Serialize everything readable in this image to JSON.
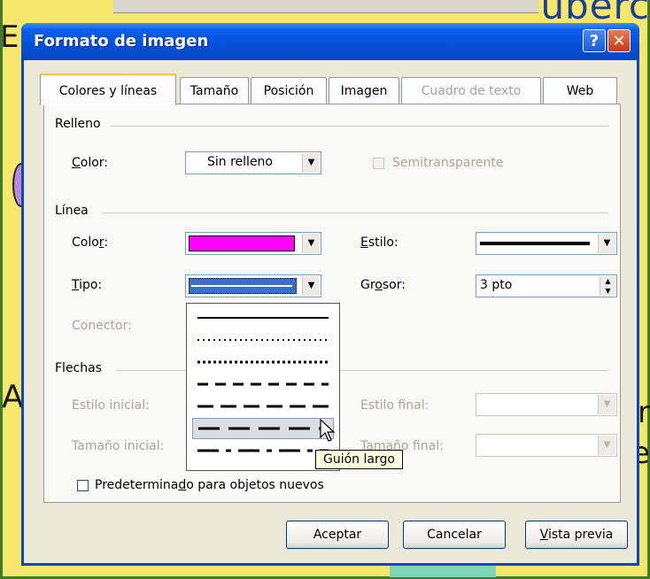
{
  "background": {
    "top_word": "uberc",
    "left_letter": "E",
    "left_letter_2": "A",
    "right_letter_1": "r",
    "right_letter_2": "e"
  },
  "dialog": {
    "title": "Formato de imagen",
    "help_label": "?",
    "close_label": "✕"
  },
  "tabs": [
    {
      "label": "Colores y líneas",
      "active": true,
      "disabled": false
    },
    {
      "label": "Tamaño",
      "active": false,
      "disabled": false
    },
    {
      "label": "Posición",
      "active": false,
      "disabled": false
    },
    {
      "label": "Imagen",
      "active": false,
      "disabled": false
    },
    {
      "label": "Cuadro de texto",
      "active": false,
      "disabled": true
    },
    {
      "label": "Web",
      "active": false,
      "disabled": false
    }
  ],
  "relleno": {
    "section": "Relleno",
    "color_label_pre": "",
    "color_label_u": "C",
    "color_label_post": "olor:",
    "color_value": "Sin relleno",
    "semitransparente": "Semitransparente"
  },
  "linea": {
    "section": "Línea",
    "color_label_pre": "Colo",
    "color_label_u": "r",
    "color_label_post": ":",
    "color_value_hex": "#ff00ff",
    "estilo_label_pre": "",
    "estilo_label_u": "E",
    "estilo_label_post": "stilo:",
    "tipo_label_pre": "",
    "tipo_label_u": "T",
    "tipo_label_post": "ipo:",
    "grosor_label_pre": "Gr",
    "grosor_label_u": "o",
    "grosor_label_post": "sor:",
    "grosor_value": "3 pto",
    "conector_label": "Conector:"
  },
  "flechas": {
    "section": "Flechas",
    "estilo_inicial": "Estilo inicial:",
    "estilo_final": "Estilo final:",
    "tamano_inicial": "Tamaño inicial:",
    "tamano_final": "Tamaño final:"
  },
  "predeterminado": {
    "pre": "Predetermina",
    "u": "d",
    "post": "o para objetos nuevos"
  },
  "line_types": [
    {
      "name": "solid"
    },
    {
      "name": "round-dot"
    },
    {
      "name": "square-dot"
    },
    {
      "name": "dash"
    },
    {
      "name": "long-dash",
      "highlighted": true
    },
    {
      "name": "long-dash-dot"
    },
    {
      "name": "long-dash-dot-dot"
    }
  ],
  "tooltip": "Guión largo",
  "buttons": {
    "aceptar": "Aceptar",
    "cancelar": "Cancelar",
    "vista_pre": "",
    "vista_u": "V",
    "vista_post": "ista previa"
  },
  "colors": {
    "title_bar": "#0550d8",
    "dialog_bg": "#ece9d8",
    "selected_type": "#3a6ec8",
    "line_color": "#ff00ff",
    "background": "#f5e76a"
  }
}
